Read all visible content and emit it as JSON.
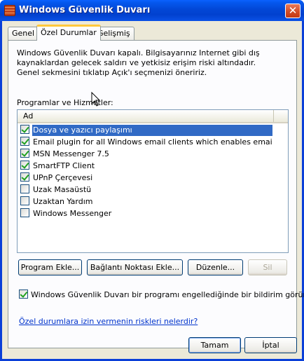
{
  "window": {
    "title": "Windows Güvenlik Duvarı",
    "close_glyph": "✕"
  },
  "tabs": [
    {
      "label": "Genel"
    },
    {
      "label": "Özel Durumlar",
      "active": true
    },
    {
      "label": "Gelişmiş"
    }
  ],
  "description": "Windows Güvenlik Duvarı kapalı. Bilgisayarınız Internet gibi dış kaynaklardan gelecek saldırı ve yetkisiz erişim riski altındadır. Genel sekmesini tıklatıp Açık'ı seçmenizi öneririz.",
  "programs_section_label": "Programlar ve Hizmetler:",
  "list": {
    "column_header": "Ad",
    "items": [
      {
        "label": "Dosya ve yazıcı paylaşımı",
        "checked": true,
        "selected": true
      },
      {
        "label": "Email plugin for all Windows email clients which enables email tracking,...",
        "checked": true
      },
      {
        "label": "MSN Messenger 7.5",
        "checked": true
      },
      {
        "label": "SmartFTP Client",
        "checked": true
      },
      {
        "label": "UPnP Çerçevesi",
        "checked": true
      },
      {
        "label": "Uzak Masaüstü",
        "checked": false
      },
      {
        "label": "Uzaktan Yardım",
        "checked": false
      },
      {
        "label": "Windows Messenger",
        "checked": false
      }
    ]
  },
  "buttons": {
    "add_program": "Program Ekle...",
    "add_port": "Bağlantı Noktası Ekle...",
    "edit": "Düzenle...",
    "delete": "Sil",
    "ok": "Tamam",
    "cancel": "İptal"
  },
  "notify_checkbox": {
    "label": "Windows Güvenlik Duvarı bir programı engellediğinde bir bildirim görüntüle",
    "checked": true
  },
  "risk_link": "Özel durumlara izin vermenin riskleri nelerdir?",
  "colors": {
    "titlebar": "#0247d6",
    "client_bg": "#ece9d8",
    "selection": "#316ac5",
    "link": "#0033cc",
    "active_tab_accent": "#ffc83c"
  },
  "icons": {
    "title_icon": "firewall-icon",
    "close_icon": "close-icon"
  }
}
